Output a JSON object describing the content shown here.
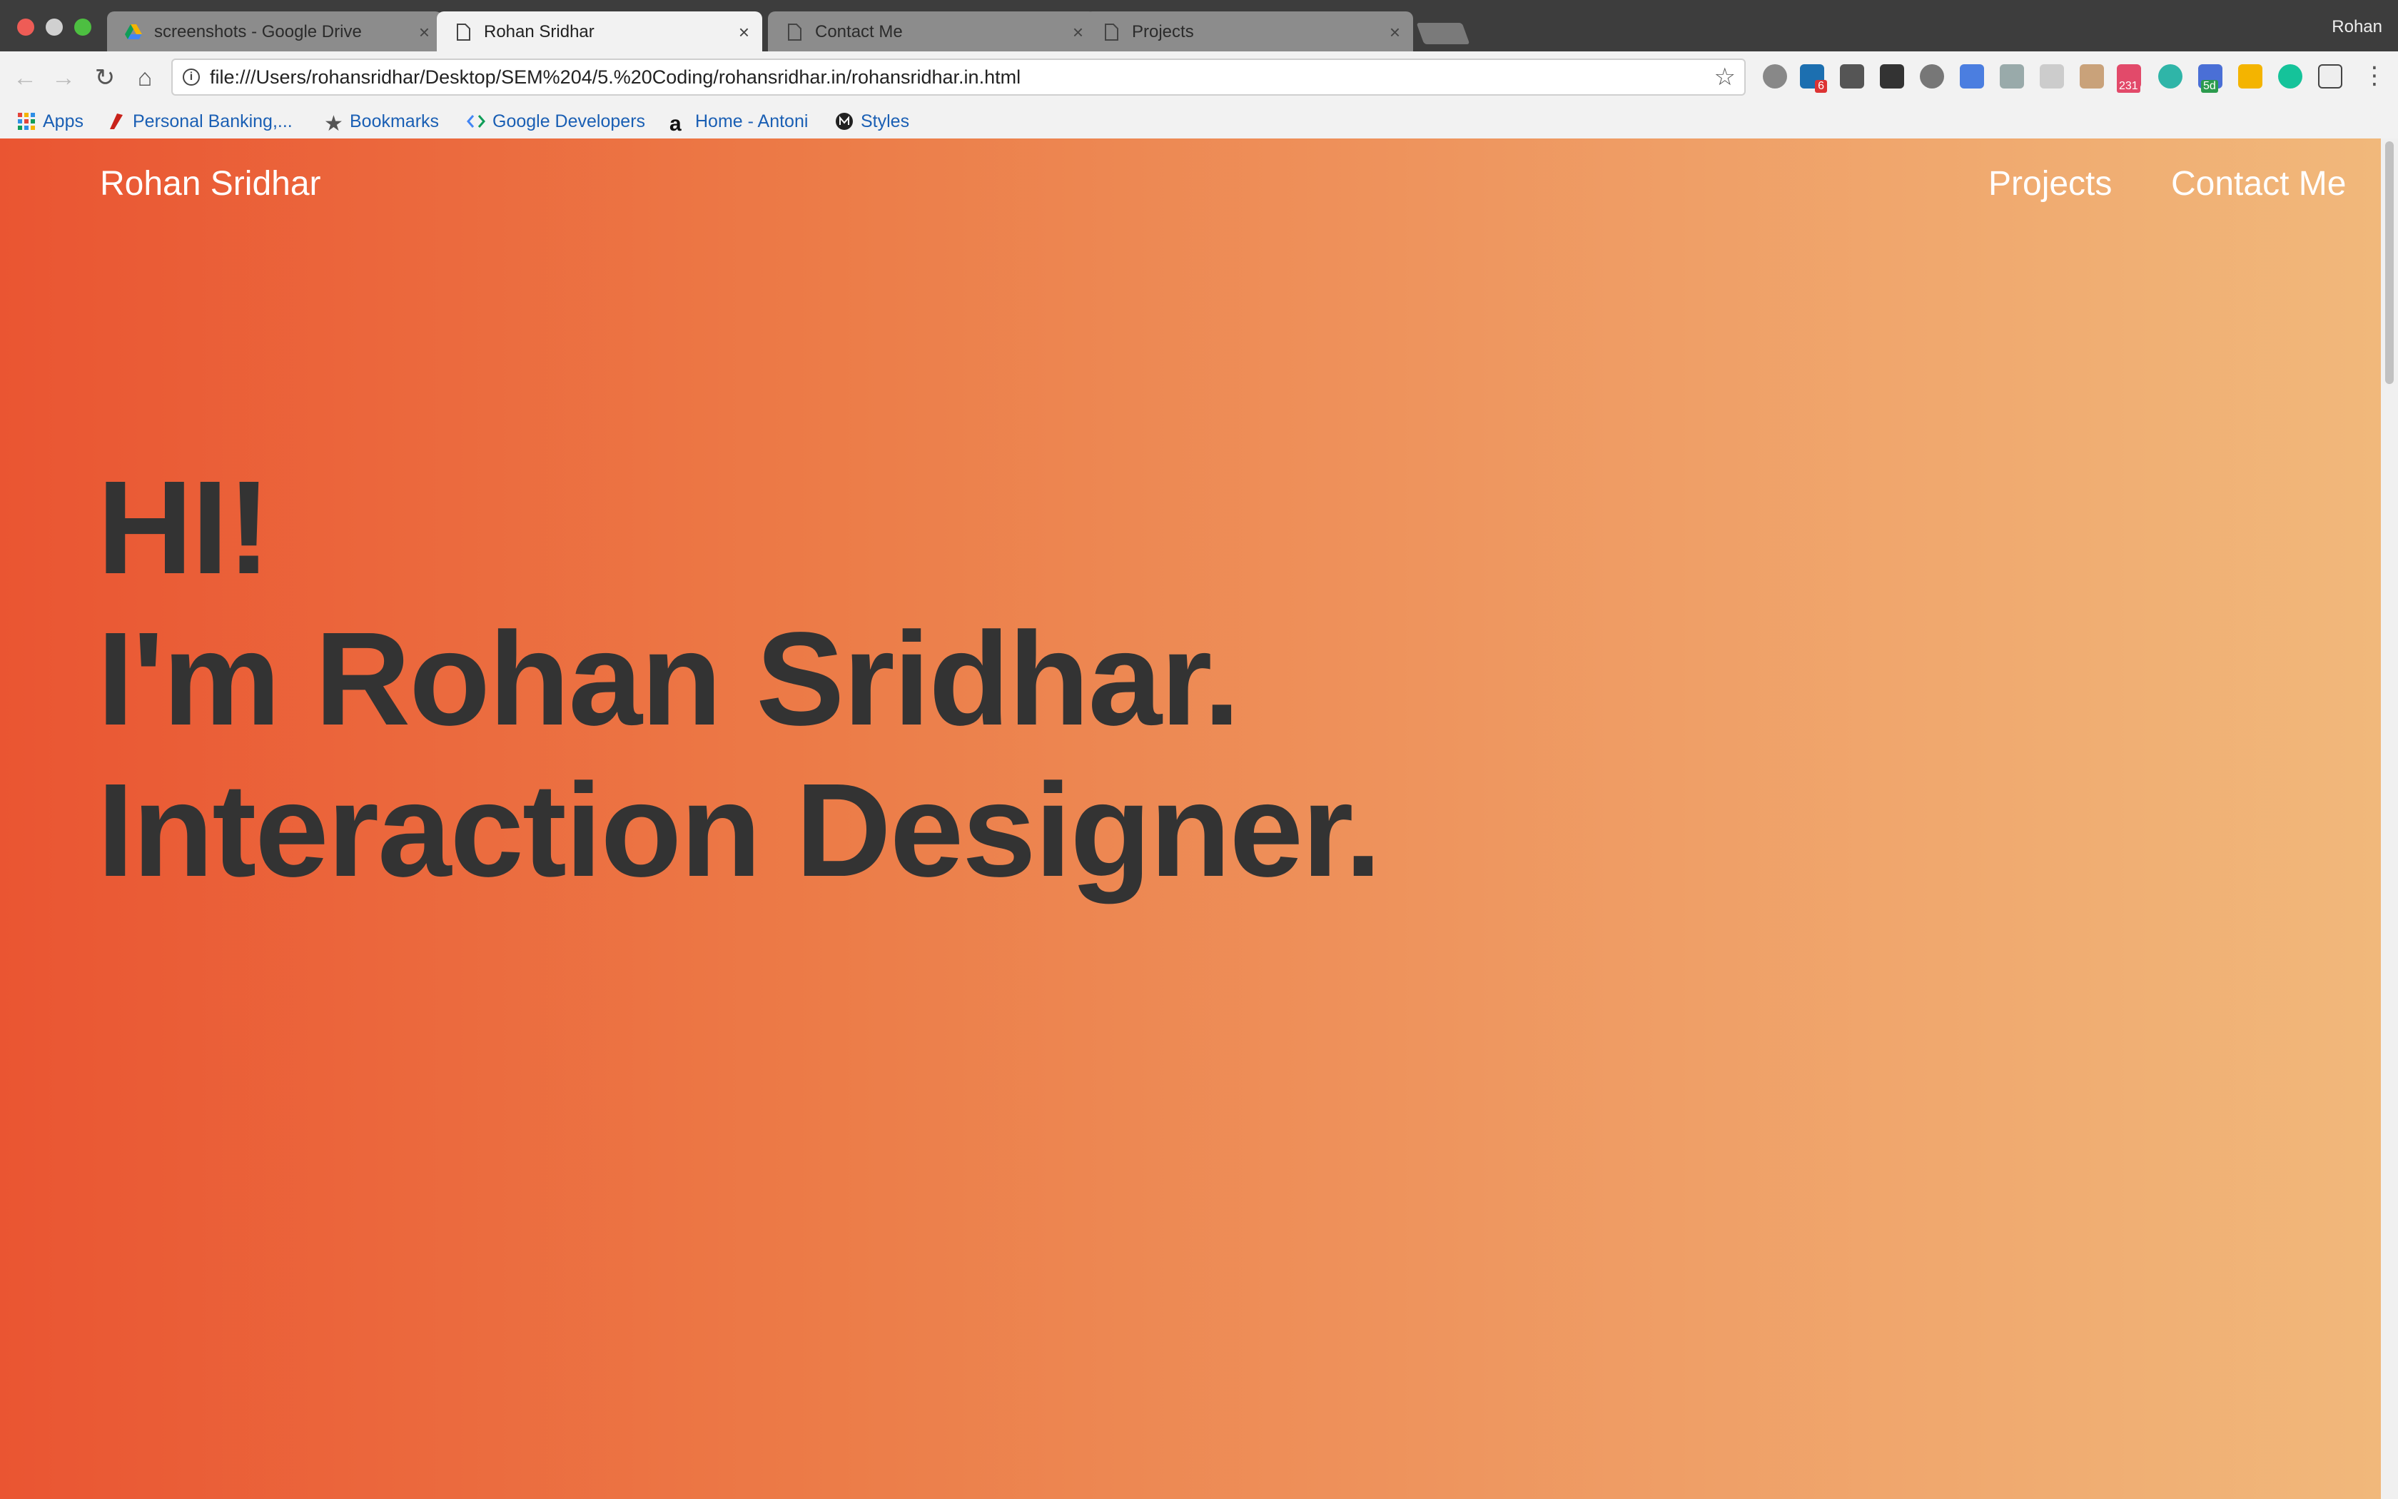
{
  "browser": {
    "tabs": [
      {
        "title": "screenshots - Google Drive",
        "icon": "google-drive-icon"
      },
      {
        "title": "Rohan Sridhar",
        "icon": "page-icon",
        "active": true
      },
      {
        "title": "Contact Me",
        "icon": "page-icon"
      },
      {
        "title": "Projects",
        "icon": "page-icon"
      }
    ],
    "profile_name": "Rohan",
    "url": "file:///Users/rohansridhar/Desktop/SEM%204/5.%20Coding/rohansridhar.in/rohansridhar.in.html",
    "extension_badges": {
      "linkedin": "6",
      "calendar": "231",
      "tasks": "5d"
    },
    "bookmarks": [
      {
        "label": "Apps",
        "icon": "apps-grid-icon"
      },
      {
        "label": "Personal Banking,...",
        "icon": "bank-icon"
      },
      {
        "label": "Bookmarks",
        "icon": "star-icon"
      },
      {
        "label": "Google Developers",
        "icon": "google-developers-icon"
      },
      {
        "label": "Home - Antoni",
        "icon": "a-logo-icon"
      },
      {
        "label": "Styles",
        "icon": "medium-icon"
      }
    ]
  },
  "site": {
    "brand": "Rohan Sridhar",
    "nav": {
      "projects": "Projects",
      "contact": "Contact Me"
    },
    "hero": {
      "line1": "HI!",
      "line2": "I'm Rohan Sridhar.",
      "line3": "Interaction Designer."
    },
    "colors": {
      "gradient_start": "#ea5532",
      "gradient_end": "#f1b87b",
      "hero_text": "#333333"
    }
  }
}
